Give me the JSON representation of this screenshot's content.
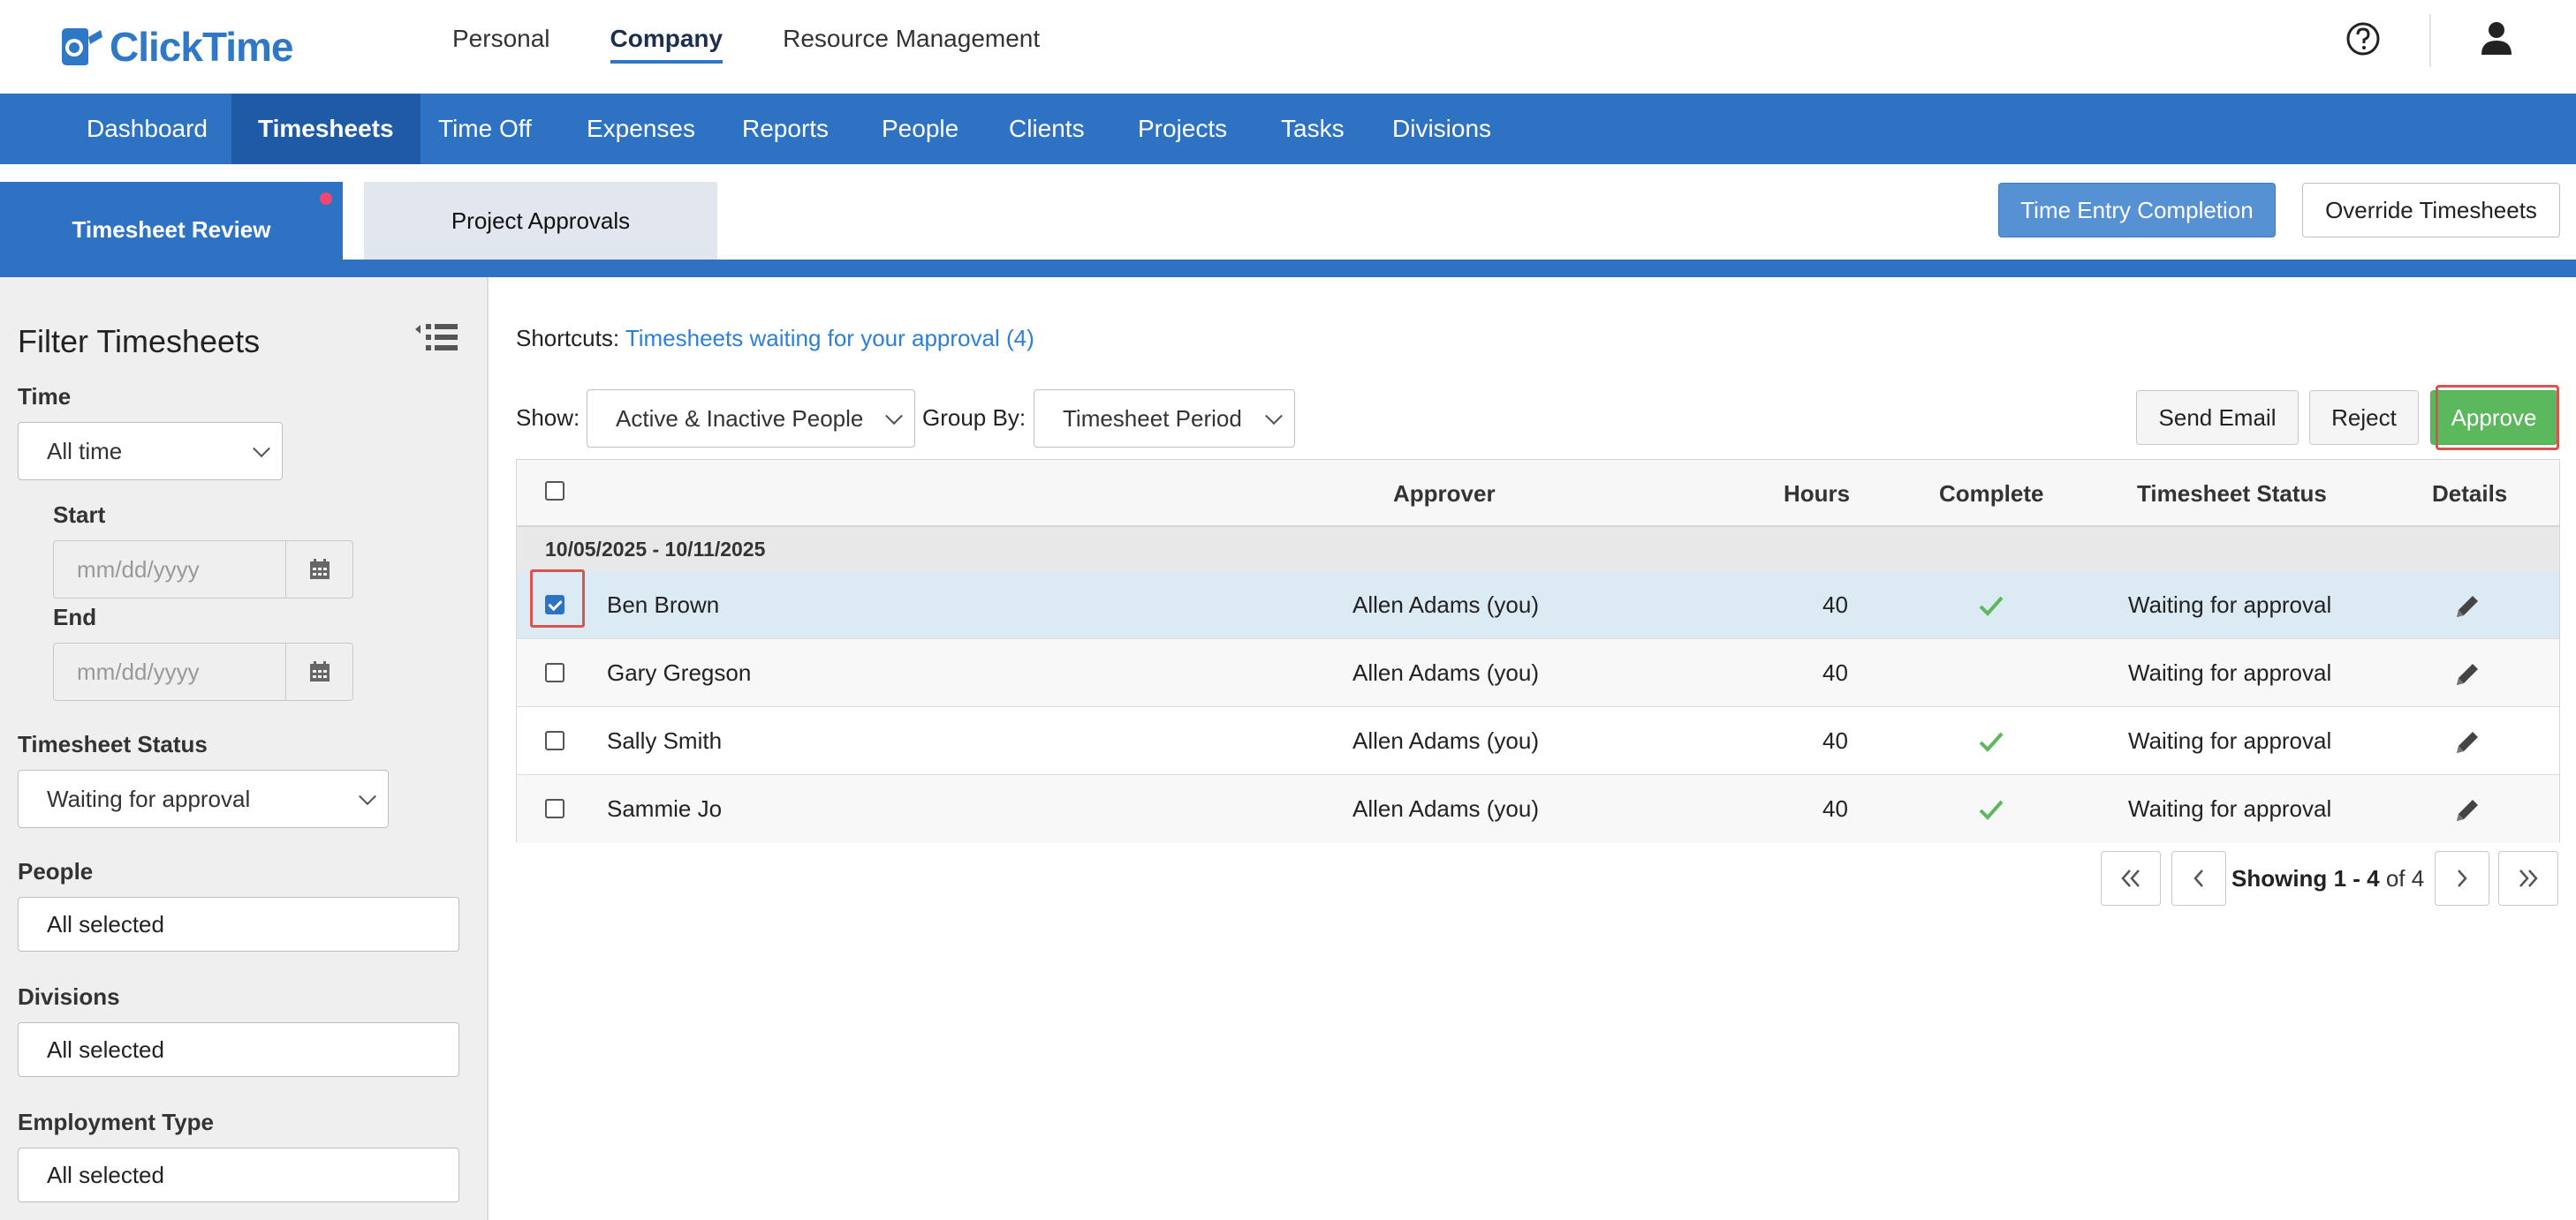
{
  "brand": {
    "name": "ClickTime",
    "color": "#2f78c6"
  },
  "top_nav": [
    {
      "label": "Personal",
      "active": false
    },
    {
      "label": "Company",
      "active": true
    },
    {
      "label": "Resource Management",
      "active": false
    }
  ],
  "main_nav": [
    {
      "label": "Dashboard",
      "active": false
    },
    {
      "label": "Timesheets",
      "active": true
    },
    {
      "label": "Time Off",
      "active": false
    },
    {
      "label": "Expenses",
      "active": false
    },
    {
      "label": "Reports",
      "active": false
    },
    {
      "label": "People",
      "active": false
    },
    {
      "label": "Clients",
      "active": false
    },
    {
      "label": "Projects",
      "active": false
    },
    {
      "label": "Tasks",
      "active": false
    },
    {
      "label": "Divisions",
      "active": false
    }
  ],
  "sub_tabs": {
    "review": "Timesheet Review",
    "approvals": "Project Approvals",
    "time_entry_completion": "Time Entry Completion",
    "override": "Override Timesheets"
  },
  "filters": {
    "title": "Filter Timesheets",
    "time_label": "Time",
    "time_value": "All time",
    "start_label": "Start",
    "start_placeholder": "mm/dd/yyyy",
    "end_label": "End",
    "end_placeholder": "mm/dd/yyyy",
    "status_label": "Timesheet Status",
    "status_value": "Waiting for approval",
    "people_label": "People",
    "people_value": "All selected",
    "divisions_label": "Divisions",
    "divisions_value": "All selected",
    "employment_label": "Employment Type",
    "employment_value": "All selected"
  },
  "shortcuts": {
    "label": "Shortcuts:",
    "link": "Timesheets waiting for your approval (4)"
  },
  "controls": {
    "show_label": "Show:",
    "show_value": "Active & Inactive People",
    "group_label": "Group By:",
    "group_value": "Timesheet Period",
    "send_email": "Send Email",
    "reject": "Reject",
    "approve": "Approve"
  },
  "table": {
    "headers": {
      "approver": "Approver",
      "hours": "Hours",
      "complete": "Complete",
      "status": "Timesheet Status",
      "details": "Details"
    },
    "group": "10/05/2025 - 10/11/2025",
    "rows": [
      {
        "name": "Ben Brown",
        "approver": "Allen Adams (you)",
        "hours": "40",
        "complete": true,
        "status": "Waiting for approval",
        "checked": true
      },
      {
        "name": "Gary Gregson",
        "approver": "Allen Adams (you)",
        "hours": "40",
        "complete": false,
        "status": "Waiting for approval",
        "checked": false
      },
      {
        "name": "Sally Smith",
        "approver": "Allen Adams (you)",
        "hours": "40",
        "complete": true,
        "status": "Waiting for approval",
        "checked": false
      },
      {
        "name": "Sammie Jo",
        "approver": "Allen Adams (you)",
        "hours": "40",
        "complete": true,
        "status": "Waiting for approval",
        "checked": false
      }
    ]
  },
  "pagination": {
    "showing": "Showing",
    "range": "1 - 4",
    "of": "of",
    "total": "4"
  },
  "colors": {
    "nav_blue": "#2e72c4",
    "nav_active": "#1e5aa5",
    "approve_green": "#5cb85c",
    "check_green": "#5cb85c",
    "highlight_red": "#d9534f"
  }
}
